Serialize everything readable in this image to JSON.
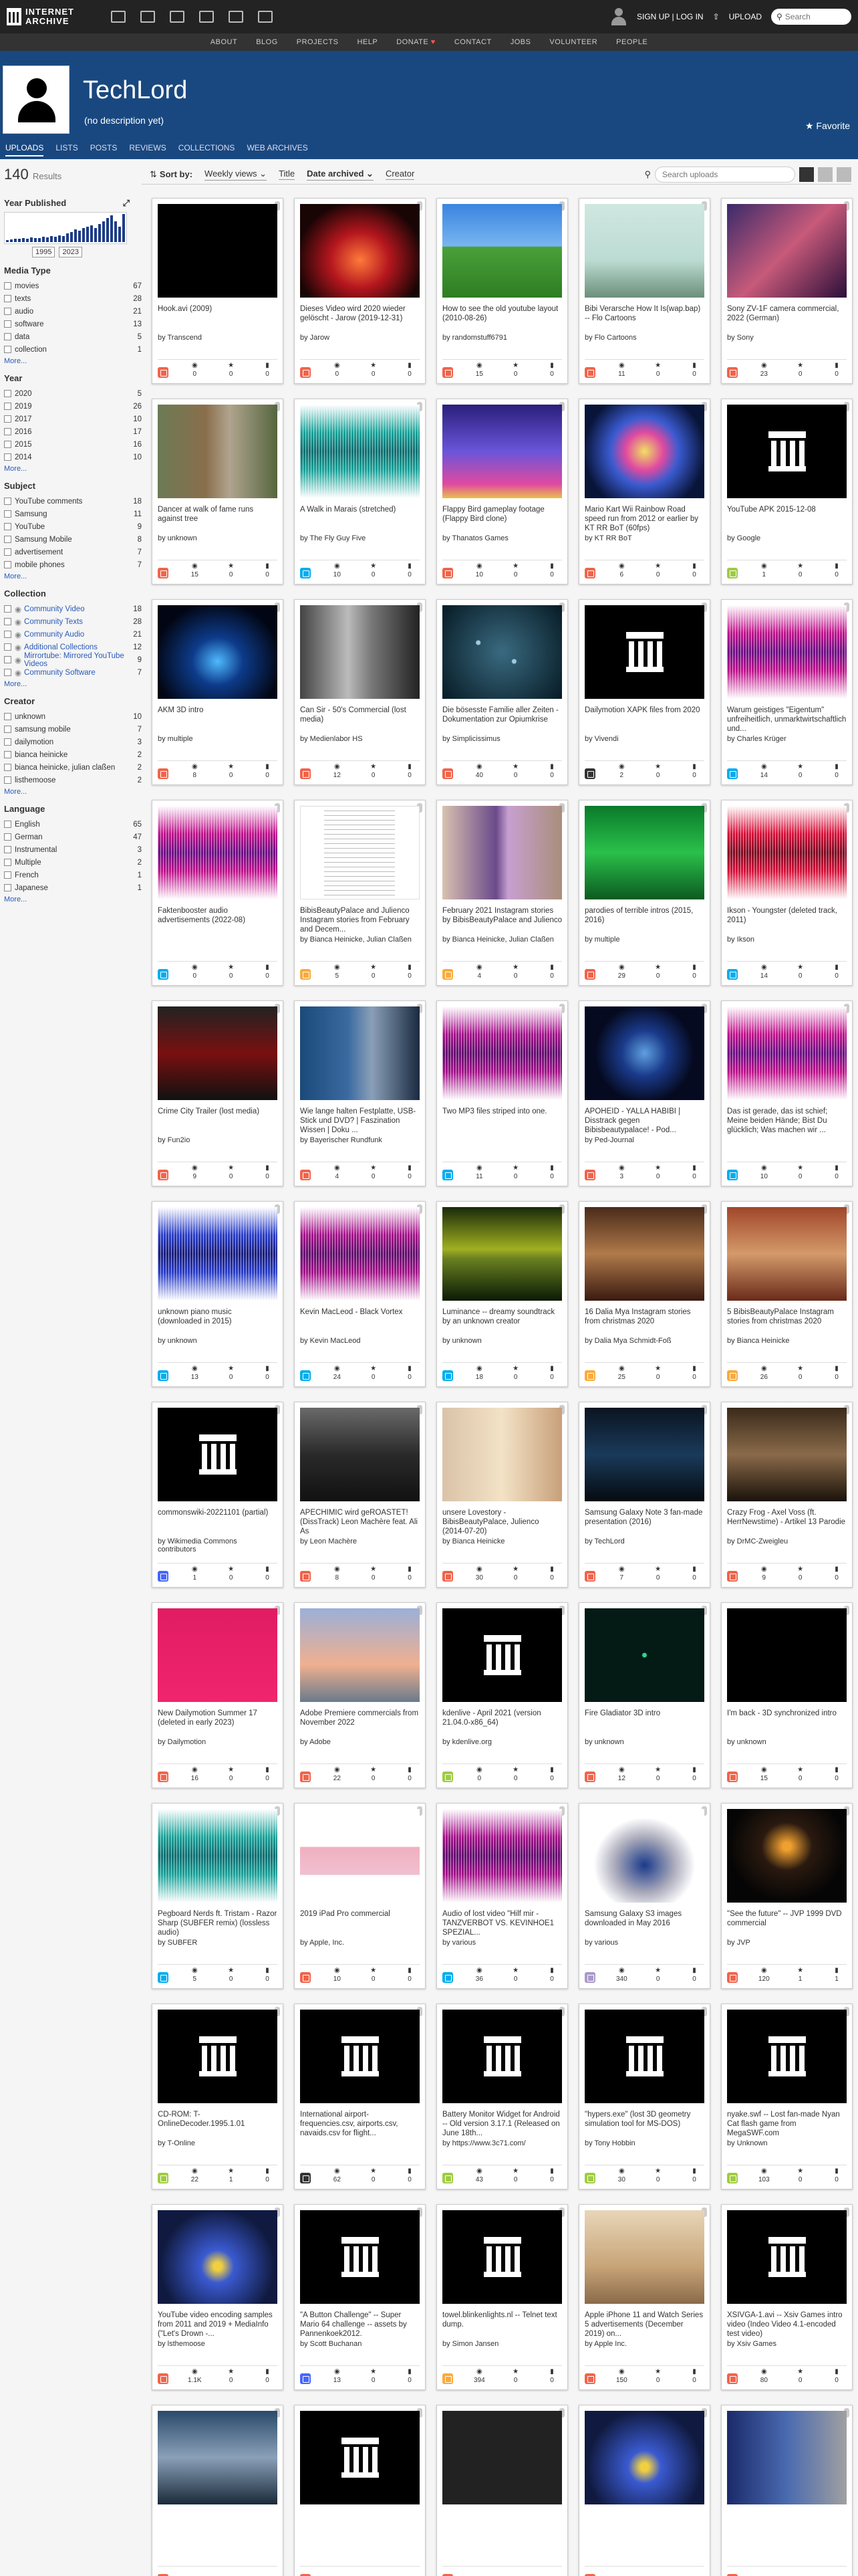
{
  "header": {
    "logo_line1": "INTERNET",
    "logo_line2": "ARCHIVE",
    "signup": "SIGN UP | LOG IN",
    "upload": "UPLOAD",
    "search_placeholder": "Search"
  },
  "nav": [
    "ABOUT",
    "BLOG",
    "PROJECTS",
    "HELP",
    "DONATE",
    "CONTACT",
    "JOBS",
    "VOLUNTEER",
    "PEOPLE"
  ],
  "banner": {
    "title": "TechLord",
    "description": "(no description yet)",
    "favorite": "Favorite"
  },
  "tabs": [
    "UPLOADS",
    "LISTS",
    "POSTS",
    "REVIEWS",
    "COLLECTIONS",
    "WEB ARCHIVES"
  ],
  "results": {
    "count": "140",
    "label": "Results"
  },
  "year_published": {
    "title": "Year Published",
    "from": "1995",
    "to": "2023",
    "hist": [
      3,
      4,
      5,
      5,
      6,
      5,
      7,
      6,
      6,
      8,
      7,
      9,
      8,
      10,
      9,
      12,
      14,
      18,
      16,
      20,
      22,
      24,
      20,
      26,
      30,
      34,
      38,
      30,
      22,
      40
    ]
  },
  "facets": [
    {
      "title": "Media Type",
      "items": [
        [
          "movies",
          "67"
        ],
        [
          "texts",
          "28"
        ],
        [
          "audio",
          "21"
        ],
        [
          "software",
          "13"
        ],
        [
          "data",
          "5"
        ],
        [
          "collection",
          "1"
        ]
      ]
    },
    {
      "title": "Year",
      "items": [
        [
          "2020",
          "5"
        ],
        [
          "2019",
          "26"
        ],
        [
          "2017",
          "10"
        ],
        [
          "2016",
          "17"
        ],
        [
          "2015",
          "16"
        ],
        [
          "2014",
          "10"
        ]
      ]
    },
    {
      "title": "Subject",
      "items": [
        [
          "YouTube comments",
          "18"
        ],
        [
          "Samsung",
          "11"
        ],
        [
          "YouTube",
          "9"
        ],
        [
          "Samsung Mobile",
          "8"
        ],
        [
          "advertisement",
          "7"
        ],
        [
          "mobile phones",
          "7"
        ]
      ]
    },
    {
      "title": "Collection",
      "items": [
        [
          "Community Video",
          "18"
        ],
        [
          "Community Texts",
          "28"
        ],
        [
          "Community Audio",
          "21"
        ],
        [
          "Additional Collections",
          "12"
        ],
        [
          "Mirrortube: Mirrored YouTube Videos",
          "9"
        ],
        [
          "Community Software",
          "7"
        ]
      ]
    },
    {
      "title": "Creator",
      "items": [
        [
          "unknown",
          "10"
        ],
        [
          "samsung mobile",
          "7"
        ],
        [
          "dailymotion",
          "3"
        ],
        [
          "bianca heinicke",
          "2"
        ],
        [
          "bianca heinicke, julian claßen",
          "2"
        ],
        [
          "listhemoose",
          "2"
        ]
      ]
    },
    {
      "title": "Language",
      "items": [
        [
          "English",
          "65"
        ],
        [
          "German",
          "47"
        ],
        [
          "Instrumental",
          "3"
        ],
        [
          "Multiple",
          "2"
        ],
        [
          "French",
          "1"
        ],
        [
          "Japanese",
          "1"
        ]
      ]
    }
  ],
  "more": "More...",
  "toolbar": {
    "sort_by": "Sort by:",
    "weekly": "Weekly views",
    "title": "Title",
    "date": "Date archived",
    "creator": "Creator",
    "search_placeholder": "Search uploads"
  },
  "items": [
    {
      "t": "Hook.avi (2009)",
      "by": "by Transcend",
      "mt": "movie",
      "v": "0",
      "f": "0",
      "r": "0",
      "th": "black"
    },
    {
      "t": "Dieses Video wird 2020 wieder gelöscht - Jarow (2019-12-31)",
      "by": "by Jarow",
      "mt": "movie",
      "v": "0",
      "f": "0",
      "r": "0",
      "th": "red"
    },
    {
      "t": "How to see the old youtube layout (2010-08-26)",
      "by": "by randomstuff6791",
      "mt": "movie",
      "v": "15",
      "f": "0",
      "r": "0",
      "th": "xp"
    },
    {
      "t": "Bibi Verarsche How It Is(wap.bap) -- Flo Cartoons",
      "by": "by Flo Cartoons",
      "mt": "movie",
      "v": "11",
      "f": "0",
      "r": "0",
      "th": "cartoon"
    },
    {
      "t": "Sony ZV-1F camera commercial, 2022 (German)",
      "by": "by Sony",
      "mt": "movie",
      "v": "23",
      "f": "0",
      "r": "0",
      "th": "face"
    },
    {
      "t": "Dancer at walk of fame runs against tree",
      "by": "by unknown",
      "mt": "movie",
      "v": "15",
      "f": "0",
      "r": "0",
      "th": "tree"
    },
    {
      "t": "A Walk in Marais (stretched)",
      "by": "by The Fly Guy Five",
      "mt": "audio",
      "v": "10",
      "f": "0",
      "r": "0",
      "th": "wave-t"
    },
    {
      "t": "Flappy Bird gameplay footage (Flappy Bird clone)",
      "by": "by Thanatos Games",
      "mt": "movie",
      "v": "10",
      "f": "0",
      "r": "0",
      "th": "flappy"
    },
    {
      "t": "Mario Kart Wii Rainbow Road speed run from 2012 or earlier by KT RR BoT (60fps)",
      "by": "by KT RR BoT",
      "mt": "movie",
      "v": "6",
      "f": "0",
      "r": "0",
      "th": "rainbow"
    },
    {
      "t": "YouTube APK 2015-12-08",
      "by": "by Google",
      "mt": "software",
      "v": "1",
      "f": "0",
      "r": "0",
      "th": "temple"
    },
    {
      "t": "AKM 3D intro",
      "by": "by multiple",
      "mt": "movie",
      "v": "8",
      "f": "0",
      "r": "0",
      "th": "blue"
    },
    {
      "t": "Can Sir - 50's Commercial (lost media)",
      "by": "by Medienlabor HS",
      "mt": "movie",
      "v": "12",
      "f": "0",
      "r": "0",
      "th": "bw"
    },
    {
      "t": "Die bösesste Familie aller Zeiten - Dokumentation zur Opiumkrise",
      "by": "by Simplicissimus",
      "mt": "movie",
      "v": "40",
      "f": "0",
      "r": "0",
      "th": "dots"
    },
    {
      "t": "Dailymotion XAPK files from 2020",
      "by": "by Vivendi",
      "mt": "data",
      "v": "2",
      "f": "0",
      "r": "0",
      "th": "temple"
    },
    {
      "t": "Warum geistiges \"Eigentum\" unfreiheitlich, unmarktwirtschaftlich und...",
      "by": "by Charles Krüger",
      "mt": "audio",
      "v": "14",
      "f": "0",
      "r": "0",
      "th": "wave-m"
    },
    {
      "t": "Faktenbooster audio advertisements (2022-08)",
      "by": "",
      "mt": "audio",
      "v": "0",
      "f": "0",
      "r": "0",
      "th": "wave-m"
    },
    {
      "t": "BibisBeautyPalace and Julienco Instagram stories from February and Decem...",
      "by": "by Bianca Heinicke, Julian Claßen",
      "mt": "text",
      "v": "5",
      "f": "0",
      "r": "0",
      "th": "doc"
    },
    {
      "t": "February 2021 Instagram stories by BibisBeautyPalace and Julienco",
      "by": "by Bianca Heinicke, Julian Claßen",
      "mt": "text",
      "v": "4",
      "f": "0",
      "r": "0",
      "th": "people"
    },
    {
      "t": "parodies of terrible intros (2015, 2016)",
      "by": "by multiple",
      "mt": "movie",
      "v": "29",
      "f": "0",
      "r": "0",
      "th": "green"
    },
    {
      "t": "Ikson - Youngster (deleted track, 2011)",
      "by": "by Ikson",
      "mt": "audio",
      "v": "14",
      "f": "0",
      "r": "0",
      "th": "wave-r"
    },
    {
      "t": "Crime City Trailer (lost media)",
      "by": "by Fun2io",
      "mt": "movie",
      "v": "9",
      "f": "0",
      "r": "0",
      "th": "crime"
    },
    {
      "t": "Wie lange halten Festplatte, USB-Stick und DVD? | Faszination Wissen | Doku ...",
      "by": "by Bayerischer Rundfunk",
      "mt": "movie",
      "v": "4",
      "f": "0",
      "r": "0",
      "th": "studio"
    },
    {
      "t": "Two MP3 files striped into one.",
      "by": "",
      "mt": "audio",
      "v": "11",
      "f": "0",
      "r": "0",
      "th": "wave-p"
    },
    {
      "t": "APOHEID - YALLA HABIBI | Disstrack gegen Bibisbeautypalace! - Pod...",
      "by": "by Ped-Journal",
      "mt": "movie",
      "v": "3",
      "f": "0",
      "r": "0",
      "th": "earth"
    },
    {
      "t": "Das ist gerade, das ist schief; Meine beiden Hände; Bist Du glücklich; Was machen wir ...",
      "by": "",
      "mt": "audio",
      "v": "10",
      "f": "0",
      "r": "0",
      "th": "wave-m"
    },
    {
      "t": "unknown piano music (downloaded in 2015)",
      "by": "by unknown",
      "mt": "audio",
      "v": "13",
      "f": "0",
      "r": "0",
      "th": "wave-b"
    },
    {
      "t": "Kevin MacLeod - Black Vortex",
      "by": "by Kevin MacLeod",
      "mt": "audio",
      "v": "24",
      "f": "0",
      "r": "0",
      "th": "wave-p"
    },
    {
      "t": "Luminance -- dreamy soundtrack by an unknown creator",
      "by": "by unknown",
      "mt": "audio",
      "v": "18",
      "f": "0",
      "r": "0",
      "th": "lum"
    },
    {
      "t": "16 Dalia Mya Instagram stories from christmas 2020",
      "by": "by Dalia Mya Schmidt-Foß",
      "mt": "text",
      "v": "25",
      "f": "0",
      "r": "0",
      "th": "portrait"
    },
    {
      "t": "5 BibisBeautyPalace Instagram stories from christmas 2020",
      "by": "by Bianca Heinicke",
      "mt": "text",
      "v": "26",
      "f": "0",
      "r": "0",
      "th": "portrait2"
    },
    {
      "t": "commonswiki-20221101 (partial)",
      "by": "by Wikimedia Commons contributors",
      "mt": "collection",
      "v": "1",
      "f": "0",
      "r": "0",
      "th": "temple"
    },
    {
      "t": "APECHIMIC wird geROASTET! (DissTrack) Leon Machère feat. Ali As",
      "by": "by Leon Machère",
      "mt": "movie",
      "v": "8",
      "f": "0",
      "r": "0",
      "th": "car"
    },
    {
      "t": "unsere Lovestory - BibisBeautyPalace, Julienco (2014-07-20)",
      "by": "by Bianca Heinicke",
      "mt": "movie",
      "v": "30",
      "f": "0",
      "r": "0",
      "th": "couple"
    },
    {
      "t": "Samsung Galaxy Note 3 fan-made presentation (2016)",
      "by": "by TechLord",
      "mt": "movie",
      "v": "7",
      "f": "0",
      "r": "0",
      "th": "dark"
    },
    {
      "t": "Crazy Frog - Axel Voss (ft. HerrNewstime) - Artikel 13 Parodie",
      "by": "by DrMC-Zweigleu",
      "mt": "movie",
      "v": "9",
      "f": "0",
      "r": "0",
      "th": "frog"
    },
    {
      "t": "New Dailymotion Summer 17 (deleted in early 2023)",
      "by": "by Dailymotion",
      "mt": "movie",
      "v": "16",
      "f": "0",
      "r": "0",
      "th": "pink"
    },
    {
      "t": "Adobe Premiere commercials from November 2022",
      "by": "by Adobe",
      "mt": "movie",
      "v": "22",
      "f": "0",
      "r": "0",
      "th": "adobe"
    },
    {
      "t": "kdenlive - April 2021 (version 21.04.0-x86_64)",
      "by": "by kdenlive.org",
      "mt": "software",
      "v": "0",
      "f": "0",
      "r": "0",
      "th": "temple"
    },
    {
      "t": "Fire Gladiator 3D intro",
      "by": "by unknown",
      "mt": "movie",
      "v": "12",
      "f": "0",
      "r": "0",
      "th": "fire"
    },
    {
      "t": "I'm back - 3D synchronized intro",
      "by": "by unknown",
      "mt": "movie",
      "v": "15",
      "f": "0",
      "r": "0",
      "th": "black"
    },
    {
      "t": "Pegboard Nerds ft. Tristam - Razor Sharp (SUBFER remix) (lossless audio)",
      "by": "by SUBFER",
      "mt": "audio",
      "v": "5",
      "f": "0",
      "r": "0",
      "th": "wave-t"
    },
    {
      "t": "2019 iPad Pro commercial",
      "by": "by Apple, Inc.",
      "mt": "movie",
      "v": "10",
      "f": "0",
      "r": "0",
      "th": "ipad"
    },
    {
      "t": "Audio of lost video \"Hilf mir - TANZVERBOT VS. KEVINHOE1 SPEZIAL...",
      "by": "by various",
      "mt": "audio",
      "v": "36",
      "f": "0",
      "r": "0",
      "th": "wave-p"
    },
    {
      "t": "Samsung Galaxy S3 images downloaded in May 2016",
      "by": "by various",
      "mt": "image",
      "v": "340",
      "f": "0",
      "r": "0",
      "th": "phone"
    },
    {
      "t": "\"See the future\" -- JVP 1999 DVD commercial",
      "by": "by JVP",
      "mt": "movie",
      "v": "120",
      "f": "1",
      "r": "1",
      "th": "road"
    },
    {
      "t": "CD-ROM: T-OnlineDecoder.1995.1.01",
      "by": "by T-Online",
      "mt": "software",
      "v": "22",
      "f": "1",
      "r": "0",
      "th": "temple"
    },
    {
      "t": "International airport-frequencies.csv, airports.csv, navaids.csv for flight...",
      "by": "",
      "mt": "data",
      "v": "62",
      "f": "0",
      "r": "0",
      "th": "temple"
    },
    {
      "t": "Battery Monitor Widget for Android -- Old version 3.17.1 (Released on June 18th...",
      "by": "by https://www.3c71.com/",
      "mt": "software",
      "v": "43",
      "f": "0",
      "r": "0",
      "th": "temple"
    },
    {
      "t": "\"hypers.exe\" (lost 3D geometry simulation tool for MS-DOS)",
      "by": "by Tony Hobbin",
      "mt": "software",
      "v": "30",
      "f": "0",
      "r": "0",
      "th": "temple"
    },
    {
      "t": "nyake.swf -- Lost fan-made Nyan Cat flash game from MegaSWF.com",
      "by": "by Unknown",
      "mt": "software",
      "v": "103",
      "f": "0",
      "r": "0",
      "th": "temple"
    },
    {
      "t": "YouTube video encoding samples from 2011 and 2019 + MediaInfo (\"Let's Drown -...",
      "by": "by lsthemoose",
      "mt": "movie",
      "v": "1.1K",
      "f": "0",
      "r": "0",
      "th": "game"
    },
    {
      "t": "\"A Button Challenge\" -- Super Mario 64 challenge -- assets by Pannenkoek2012.",
      "by": "by Scott Buchanan",
      "mt": "collection",
      "v": "13",
      "f": "0",
      "r": "0",
      "th": "temple"
    },
    {
      "t": "towel.blinkenlights.nl -- Telnet text dump.",
      "by": "by Simon Jansen",
      "mt": "text",
      "v": "394",
      "f": "0",
      "r": "0",
      "th": "temple"
    },
    {
      "t": "Apple iPhone 11 and Watch Series 5 advertisements (December 2019) on...",
      "by": "by Apple Inc.",
      "mt": "movie",
      "v": "150",
      "f": "0",
      "r": "0",
      "th": "sand"
    },
    {
      "t": "XSIVGA-1.avi -- Xsiv Games intro video (Indeo Video 4.1-encoded test video)",
      "by": "by Xsiv Games",
      "mt": "movie",
      "v": "80",
      "f": "0",
      "r": "0",
      "th": "temple"
    },
    {
      "t": "",
      "by": "",
      "mt": "movie",
      "v": "",
      "f": "",
      "r": "",
      "th": "city"
    },
    {
      "t": "",
      "by": "",
      "mt": "movie",
      "v": "",
      "f": "",
      "r": "",
      "th": "temple"
    },
    {
      "t": "",
      "by": "",
      "mt": "movie",
      "v": "",
      "f": "",
      "r": "",
      "th": "timer"
    },
    {
      "t": "",
      "by": "",
      "mt": "movie",
      "v": "",
      "f": "",
      "r": "",
      "th": "game"
    },
    {
      "t": "",
      "by": "",
      "mt": "movie",
      "v": "",
      "f": "",
      "r": "",
      "th": "news"
    }
  ],
  "colors": {
    "movie": "#f1644b",
    "audio": "#00adef",
    "text": "#faab3c",
    "software": "#9ecc42",
    "data": "#333333",
    "image": "#aa99c9",
    "collection": "#4666ff"
  }
}
